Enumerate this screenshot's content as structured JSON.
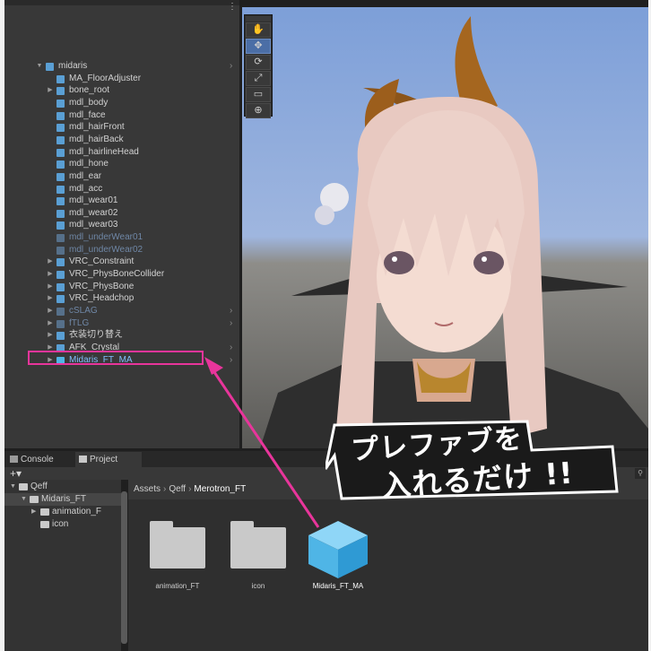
{
  "hierarchy": {
    "menu_glyph": "⋮",
    "items": [
      {
        "label": "midaris",
        "depth": 0,
        "foldout": "▼",
        "icon": "prefab-cube",
        "style": "norm",
        "chevron": true
      },
      {
        "label": "MA_FloorAdjuster",
        "depth": 1,
        "foldout": "",
        "icon": "cube",
        "style": "norm",
        "chevron": false
      },
      {
        "label": "bone_root",
        "depth": 1,
        "foldout": "▶",
        "icon": "cube",
        "style": "norm",
        "chevron": false
      },
      {
        "label": "mdl_body",
        "depth": 1,
        "foldout": "",
        "icon": "cube",
        "style": "norm",
        "chevron": false
      },
      {
        "label": "mdl_face",
        "depth": 1,
        "foldout": "",
        "icon": "cube",
        "style": "norm",
        "chevron": false
      },
      {
        "label": "mdl_hairFront",
        "depth": 1,
        "foldout": "",
        "icon": "cube",
        "style": "norm",
        "chevron": false
      },
      {
        "label": "mdl_hairBack",
        "depth": 1,
        "foldout": "",
        "icon": "cube",
        "style": "norm",
        "chevron": false
      },
      {
        "label": "mdl_hairlineHead",
        "depth": 1,
        "foldout": "",
        "icon": "cube",
        "style": "norm",
        "chevron": false
      },
      {
        "label": "mdl_hone",
        "depth": 1,
        "foldout": "",
        "icon": "cube",
        "style": "norm",
        "chevron": false
      },
      {
        "label": "mdl_ear",
        "depth": 1,
        "foldout": "",
        "icon": "cube",
        "style": "norm",
        "chevron": false
      },
      {
        "label": "mdl_acc",
        "depth": 1,
        "foldout": "",
        "icon": "cube",
        "style": "norm",
        "chevron": false
      },
      {
        "label": "mdl_wear01",
        "depth": 1,
        "foldout": "",
        "icon": "cube",
        "style": "norm",
        "chevron": false
      },
      {
        "label": "mdl_wear02",
        "depth": 1,
        "foldout": "",
        "icon": "cube",
        "style": "norm",
        "chevron": false
      },
      {
        "label": "mdl_wear03",
        "depth": 1,
        "foldout": "",
        "icon": "cube",
        "style": "norm",
        "chevron": false
      },
      {
        "label": "mdl_underWear01",
        "depth": 1,
        "foldout": "",
        "icon": "cube",
        "style": "dim",
        "chevron": false
      },
      {
        "label": "mdl_underWear02",
        "depth": 1,
        "foldout": "",
        "icon": "cube",
        "style": "dim",
        "chevron": false
      },
      {
        "label": "VRC_Constraint",
        "depth": 1,
        "foldout": "▶",
        "icon": "cube",
        "style": "norm",
        "chevron": false
      },
      {
        "label": "VRC_PhysBoneCollider",
        "depth": 1,
        "foldout": "▶",
        "icon": "cube",
        "style": "norm",
        "chevron": false
      },
      {
        "label": "VRC_PhysBone",
        "depth": 1,
        "foldout": "▶",
        "icon": "cube",
        "style": "norm",
        "chevron": false
      },
      {
        "label": "VRC_Headchop",
        "depth": 1,
        "foldout": "▶",
        "icon": "cube",
        "style": "norm",
        "chevron": false
      },
      {
        "label": "cSLAG",
        "depth": 1,
        "foldout": "▶",
        "icon": "prefab-cube",
        "style": "dim",
        "chevron": true
      },
      {
        "label": "fTLG",
        "depth": 1,
        "foldout": "▶",
        "icon": "prefab-cube",
        "style": "dim",
        "chevron": true
      },
      {
        "label": "衣装切り替え",
        "depth": 1,
        "foldout": "▶",
        "icon": "cube",
        "style": "norm",
        "chevron": false
      },
      {
        "label": "AFK_Crystal",
        "depth": 1,
        "foldout": "▶",
        "icon": "prefab-cube",
        "style": "norm",
        "chevron": true
      },
      {
        "label": "Midaris_FT_MA",
        "depth": 1,
        "foldout": "▶",
        "icon": "prefab-cube",
        "style": "pf",
        "chevron": true
      }
    ]
  },
  "scene_tools": [
    "hand-tool",
    "move-tool",
    "rotate-tool",
    "scale-tool",
    "rect-tool",
    "transform-tool"
  ],
  "scene_tool_glyphs": [
    "✋",
    "✥",
    "⟳",
    "⤢",
    "▭",
    "⊕"
  ],
  "bottom_tabs": [
    {
      "label": "Console",
      "active": false
    },
    {
      "label": "Project",
      "active": true
    }
  ],
  "project": {
    "add_glyph": "+▾",
    "search_glyph": "⚲",
    "tree": [
      {
        "label": "Qeff",
        "foldout": "▼",
        "depth": 0,
        "selected": false
      },
      {
        "label": "Midaris_FT",
        "foldout": "▼",
        "depth": 1,
        "selected": true
      },
      {
        "label": "animation_F",
        "foldout": "▶",
        "depth": 2,
        "selected": false
      },
      {
        "label": "icon",
        "foldout": "",
        "depth": 2,
        "selected": false
      }
    ],
    "breadcrumb": [
      "Assets",
      "Qeff",
      "Merotron_FT"
    ],
    "assets": [
      {
        "label": "animation_FT",
        "kind": "folder"
      },
      {
        "label": "icon",
        "kind": "folder"
      },
      {
        "label": "Midaris_FT_MA",
        "kind": "prefab"
      }
    ]
  },
  "callout": {
    "line1": "プレファブを",
    "line2": "入れるだけ !!",
    "color": "#e8359b"
  }
}
